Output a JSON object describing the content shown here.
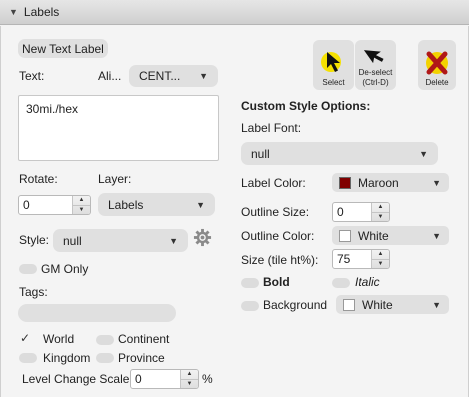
{
  "header": {
    "title": "Labels"
  },
  "left": {
    "new_text_label_button": "New Text Label",
    "text_label": "Text:",
    "alignment_label": "Ali...",
    "alignment_value": "CENT...",
    "text_value": "30mi./hex",
    "rotate_label": "Rotate:",
    "layer_label": "Layer:",
    "rotate_value": "0",
    "layer_value": "Labels",
    "style_label": "Style:",
    "style_value": "null",
    "gm_only_label": "GM Only",
    "tags_label": "Tags:",
    "tags_value": "",
    "scale_world": "World",
    "scale_continent": "Continent",
    "scale_kingdom": "Kingdom",
    "scale_province": "Province",
    "check_glyph": "✓",
    "level_change_label": "Level Change Scale:",
    "level_change_value": "0",
    "percent": "%"
  },
  "toolbar": {
    "select": "Select",
    "deselect_line1": "De-select",
    "deselect_line2": "(Ctrl-D)",
    "delete": "Delete"
  },
  "right": {
    "section_title": "Custom Style Options:",
    "label_font_label": "Label Font:",
    "label_font_value": "null",
    "label_color_label": "Label Color:",
    "label_color_value": "Maroon",
    "label_color_hex": "#800000",
    "outline_size_label": "Outline Size:",
    "outline_size_value": "0",
    "outline_color_label": "Outline Color:",
    "outline_color_value": "White",
    "outline_color_hex": "#ffffff",
    "size_label": "Size (tile ht%):",
    "size_value": "75",
    "bold_label": "Bold",
    "italic_label": "Italic",
    "background_label": "Background",
    "background_value": "White",
    "background_hex": "#ffffff"
  },
  "colors": {
    "select_highlight": "#f5e100",
    "delete_red": "#b01818",
    "delete_yellow": "#f3d200"
  }
}
